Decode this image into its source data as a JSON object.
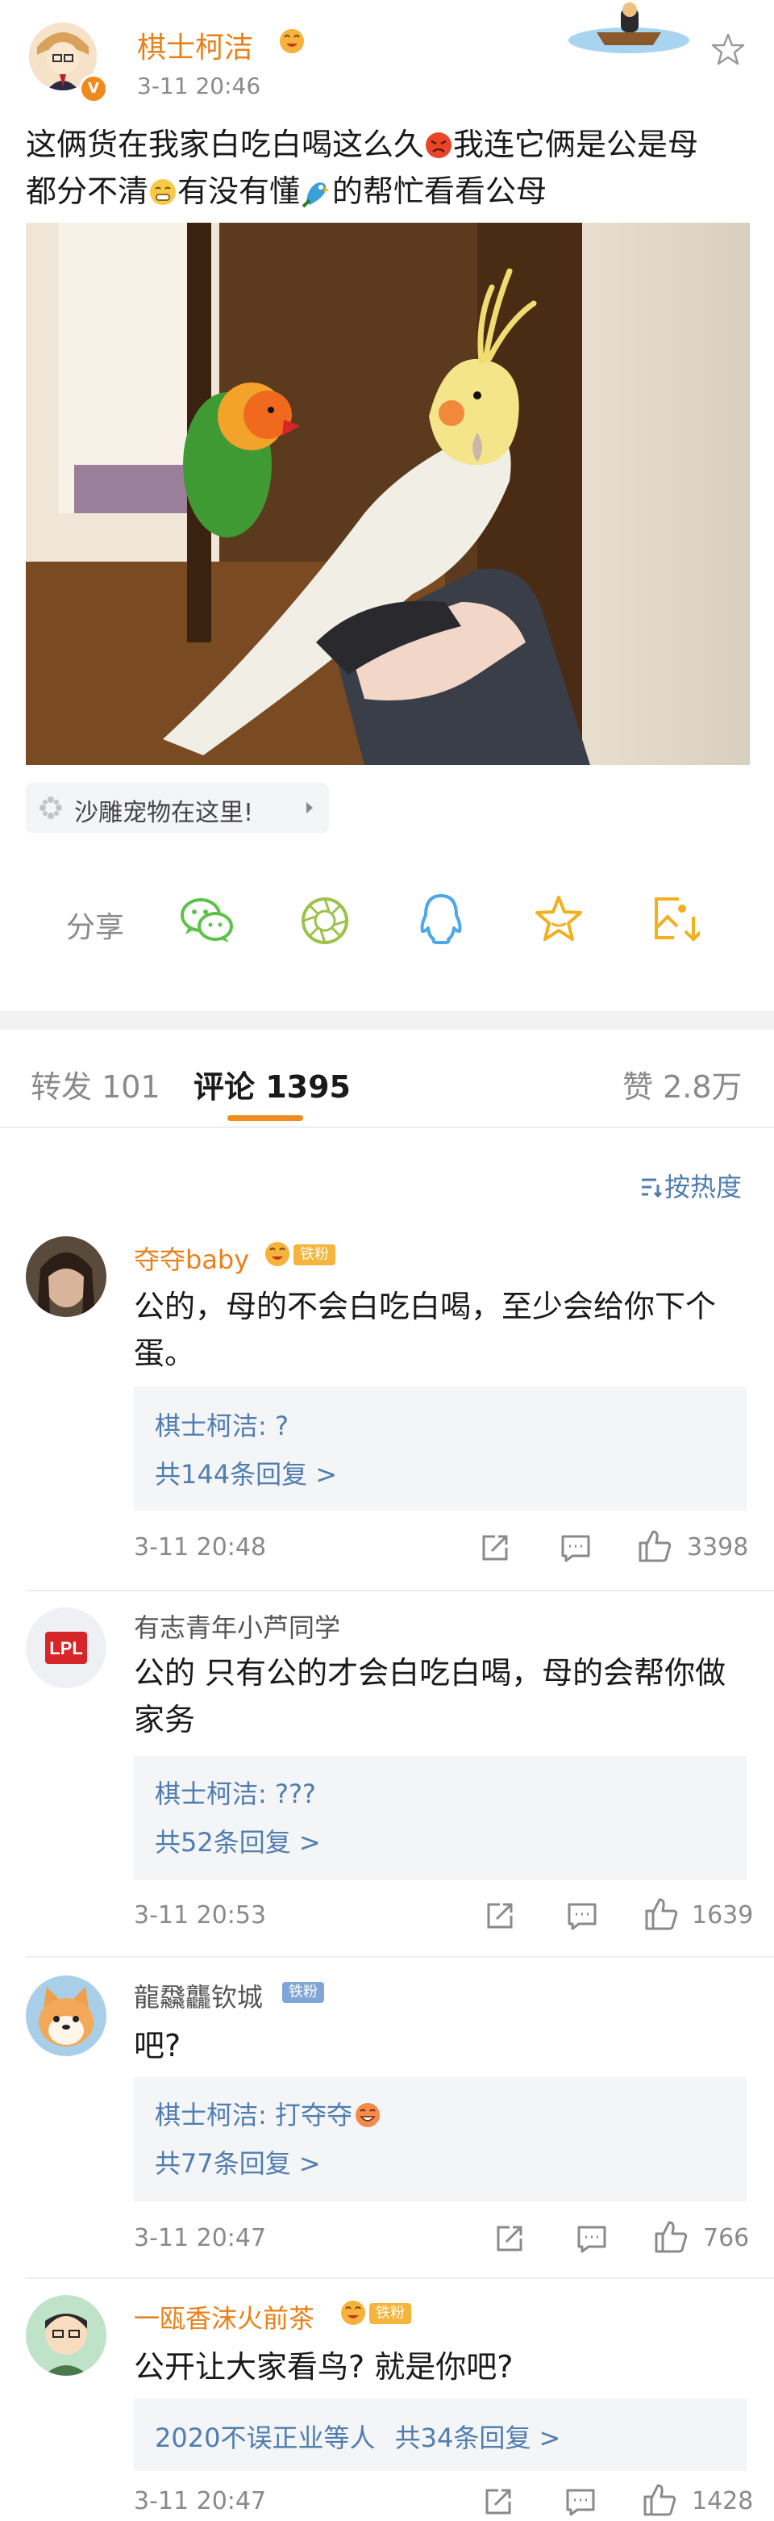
{
  "post": {
    "author": "棋士柯洁",
    "time": "3-11 20:46",
    "text_line1": "这俩货在我家白吃白喝这么久",
    "text_line1b": "我连它俩是公是母",
    "text_line2a": "都分不清",
    "text_line2b": "有没有懂",
    "text_line2c": "的帮忙看看公母",
    "topic": "沙雕宠物在这里!"
  },
  "share": {
    "label": "分享"
  },
  "tabs": {
    "repost": "转发 101",
    "comment": "评论 1395",
    "like": "赞 2.8万"
  },
  "sort": {
    "label": "按热度"
  },
  "comments": [
    {
      "user": "夺夺baby",
      "badge": "铁粉",
      "line1": "公的，母的不会白吃白喝，至少会给你下个",
      "line2": "蛋。",
      "reply": "棋士柯洁: ?",
      "more": "共144条回复 >",
      "time": "3-11 20:48",
      "likes": "3398"
    },
    {
      "user": "有志青年小芦同学",
      "line1": "公的 只有公的才会白吃白喝，母的会帮你做",
      "line2": "家务",
      "reply": "棋士柯洁: ???",
      "more": "共52条回复 >",
      "time": "3-11 20:53",
      "likes": "1639"
    },
    {
      "user": "龍飝龘钦城",
      "badge": "铁粉",
      "line1": "吧?",
      "reply": "棋士柯洁: 打夺夺",
      "more": "共77条回复 >",
      "time": "3-11 20:47",
      "likes": "766"
    },
    {
      "user": "一瓯香沫火前茶",
      "badge": "铁粉",
      "line1": "公开让大家看鸟? 就是你吧?",
      "reply_user": "2020不误正业等人",
      "more": "共34条回复 >",
      "time": "3-11 20:47",
      "likes": "1428"
    }
  ],
  "colors": {
    "accent": "#e8811a",
    "link": "#4f7db0",
    "wechat": "#5cc24a",
    "moments": "#9bc34a",
    "qq": "#4ea8e8",
    "favorite": "#f2b01e"
  }
}
